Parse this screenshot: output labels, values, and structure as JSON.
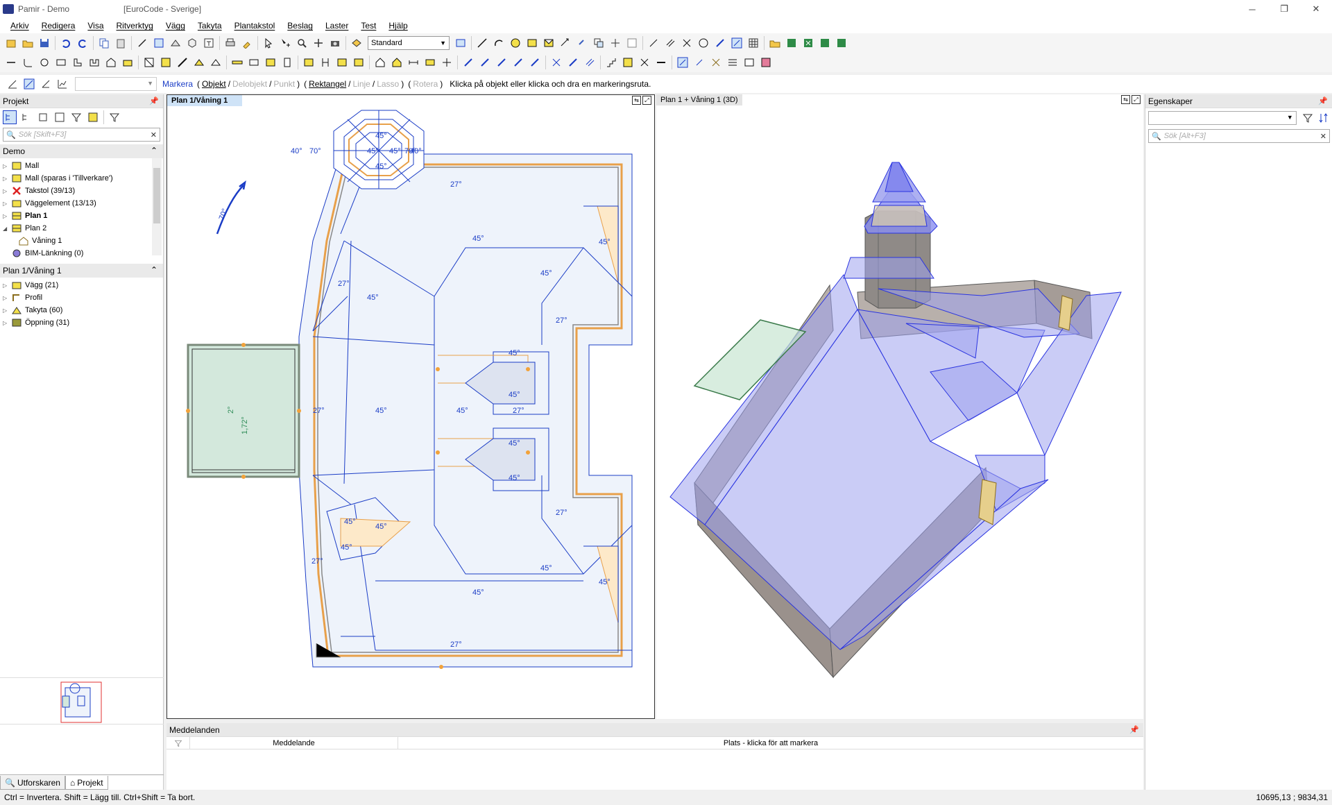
{
  "window": {
    "app_title": "Pamir - Demo",
    "code_title": "[EuroCode - Sverige]",
    "minimize_glyph": "─",
    "restore_glyph": "❐",
    "close_glyph": "✕"
  },
  "menu": [
    "Arkiv",
    "Redigera",
    "Visa",
    "Ritverktyg",
    "Vägg",
    "Takyta",
    "Plantakstol",
    "Beslag",
    "Laster",
    "Test",
    "Hjälp"
  ],
  "toolbar": {
    "style_combo": "Standard"
  },
  "selection_bar": {
    "mode_label": "Markera",
    "options": [
      "Objekt",
      "Delobjekt",
      "Punkt",
      "Rektangel",
      "Linje",
      "Lasso",
      "Rotera"
    ],
    "paren_open": "(",
    "paren_close": ")",
    "slash": "/",
    "hint": "Klicka på objekt eller klicka och dra en markeringsruta."
  },
  "left_panel": {
    "title": "Projekt",
    "search_placeholder": "Sök [Skift+F3]",
    "section1_title": "Demo",
    "tree1": [
      {
        "label": "Mall",
        "bold": false,
        "indent": 0
      },
      {
        "label": "Mall (sparas i 'Tillverkare')",
        "bold": false,
        "indent": 0
      },
      {
        "label": "Takstol (39/13)",
        "bold": false,
        "indent": 0
      },
      {
        "label": "Väggelement (13/13)",
        "bold": false,
        "indent": 0
      },
      {
        "label": "Plan 1",
        "bold": true,
        "indent": 0
      },
      {
        "label": "Plan 2",
        "bold": false,
        "indent": 0
      },
      {
        "label": "Våning 1",
        "bold": false,
        "indent": 1
      },
      {
        "label": "BIM-Länkning (0)",
        "bold": false,
        "indent": 0
      }
    ],
    "section2_title": "Plan 1/Våning 1",
    "tree2": [
      {
        "label": "Vägg (21)"
      },
      {
        "label": "Profil"
      },
      {
        "label": "Takyta (60)"
      },
      {
        "label": "Öppning (31)"
      }
    ],
    "tabs": [
      "Utforskaren",
      "Projekt"
    ]
  },
  "view2d": {
    "tab": "Plan 1/Våning 1",
    "angle_labels": {
      "north_arrow": "70°",
      "a27": "27°",
      "a45": "45°",
      "a40": "40°",
      "a70": "70°",
      "dim_w": "1,72°",
      "dim_h": "2°"
    }
  },
  "view3d": {
    "tab": "Plan 1 + Våning 1 (3D)"
  },
  "right_panel": {
    "title": "Egenskaper",
    "search_placeholder": "Sök [Alt+F3]"
  },
  "messages": {
    "title": "Meddelanden",
    "col_message": "Meddelande",
    "col_location": "Plats - klicka för att markera"
  },
  "statusbar": {
    "hint": "Ctrl = Invertera. Shift = Lägg till. Ctrl+Shift = Ta bort.",
    "coords": "10695,13 ; 9834,31"
  },
  "colors": {
    "accent_blue": "#1a3cc6",
    "roof_fill": "#eef3fb",
    "wall_orange": "#e8a04a",
    "terrace_green": "#d3e8dc",
    "roof3d": "#9fa2ef"
  }
}
